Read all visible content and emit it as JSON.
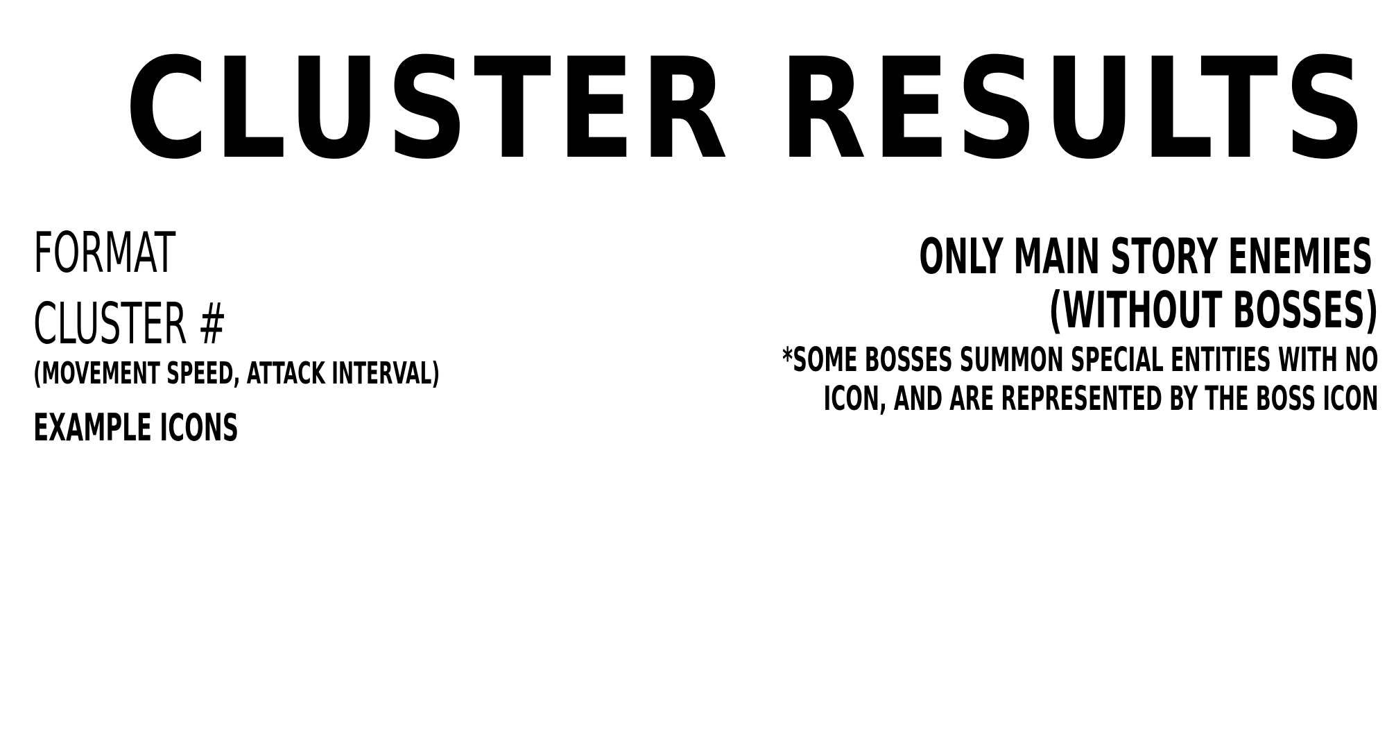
{
  "title": "CLUSTER RESULTS",
  "format": {
    "label": "FORMAT",
    "cluster_label": "CLUSTER #",
    "sub_label": "(MOVEMENT SPEED,  ATTACK INTERVAL)",
    "example_label": "EXAMPLE  ICONS"
  },
  "notes": {
    "line1": "ONLY MAIN STORY ENEMIES",
    "line2": "(WITHOUT BOSSES)",
    "footnote_line1": "*SOME BOSSES SUMMON SPECIAL ENTITIES WITH NO",
    "footnote_line2": "ICON, AND ARE REPRESENTED BY THE BOSS ICON"
  }
}
